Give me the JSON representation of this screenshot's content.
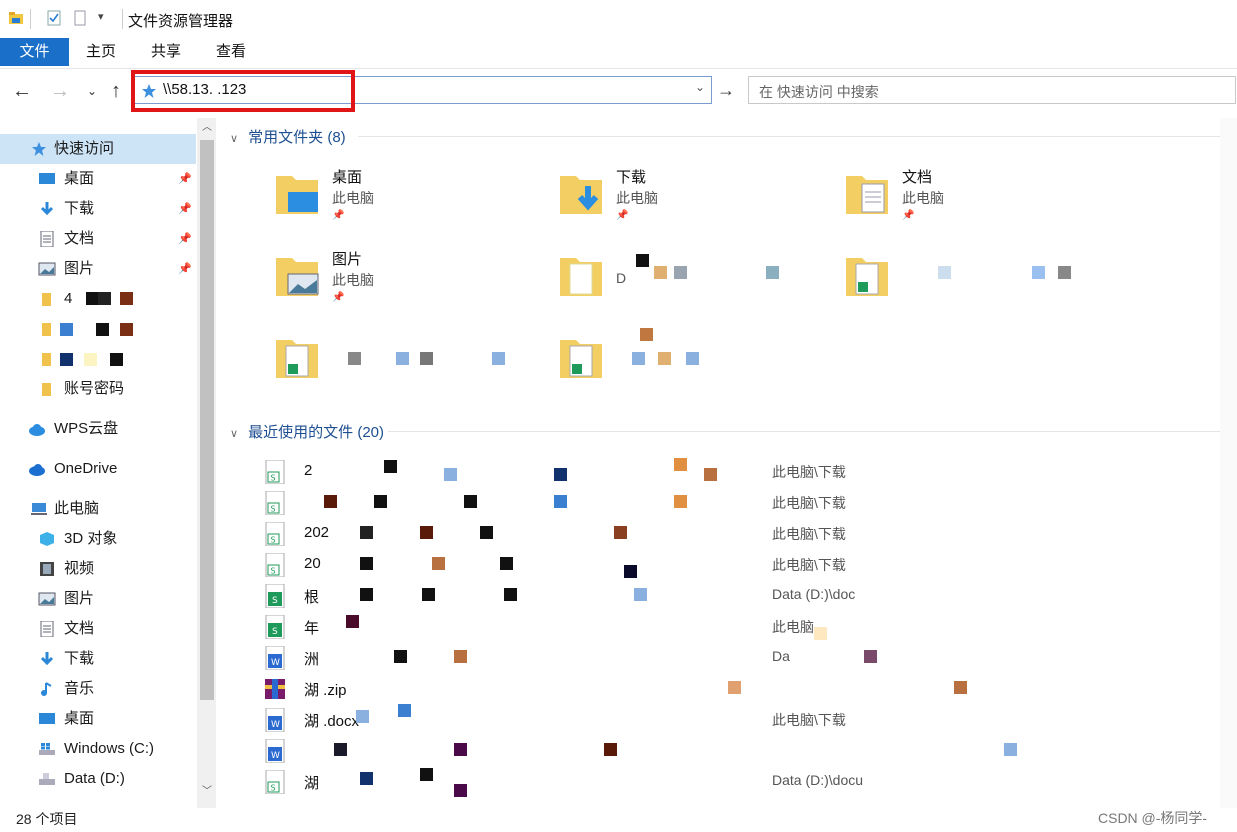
{
  "window": {
    "title": "文件资源管理器"
  },
  "ribbon": {
    "tabs": [
      "文件",
      "主页",
      "共享",
      "查看"
    ]
  },
  "address": {
    "path": "\\\\58.13.   .123",
    "search_placeholder": "在 快速访问 中搜索"
  },
  "sidebar": {
    "quick_access": "快速访问",
    "quick_items": [
      {
        "label": "桌面",
        "pinned": true
      },
      {
        "label": "下载",
        "pinned": true
      },
      {
        "label": "文档",
        "pinned": true
      },
      {
        "label": "图片",
        "pinned": true
      },
      {
        "label": "4",
        "pinned": false
      },
      {
        "label": "",
        "pinned": false
      },
      {
        "label": "",
        "pinned": false
      },
      {
        "label": "账号密码",
        "pinned": false
      }
    ],
    "wps": "WPS云盘",
    "onedrive": "OneDrive",
    "this_pc": "此电脑",
    "pc_items": [
      "3D 对象",
      "视频",
      "图片",
      "文档",
      "下载",
      "音乐",
      "桌面",
      "Windows (C:)",
      "Data (D:)"
    ]
  },
  "main": {
    "frequent_header": "常用文件夹 (8)",
    "frequent": [
      {
        "name": "桌面",
        "sub": "此电脑"
      },
      {
        "name": "下载",
        "sub": "此电脑"
      },
      {
        "name": "文档",
        "sub": "此电脑"
      },
      {
        "name": "图片",
        "sub": "此电脑"
      },
      {
        "name": "",
        "sub": "D"
      },
      {
        "name": "",
        "sub": ""
      },
      {
        "name": "",
        "sub": ""
      },
      {
        "name": "",
        "sub": ""
      }
    ],
    "recent_header": "最近使用的文件 (20)",
    "recent": [
      {
        "name": "2",
        "loc": "此电脑\\下载",
        "icon": "excel"
      },
      {
        "name": "",
        "loc": "此电脑\\下载",
        "icon": "excel"
      },
      {
        "name": "202",
        "loc": "此电脑\\下载",
        "icon": "excel"
      },
      {
        "name": "20",
        "loc": "此电脑\\下载",
        "icon": "excel"
      },
      {
        "name": "根",
        "loc": "Data (D:)\\doc",
        "icon": "excel-green"
      },
      {
        "name": "年",
        "loc": "此电脑",
        "icon": "excel-green"
      },
      {
        "name": "洲",
        "loc": "Da",
        "icon": "word"
      },
      {
        "name": "湖                    .zip",
        "loc": "",
        "icon": "rar"
      },
      {
        "name": "湖                    .docx",
        "loc": "此电脑\\下载",
        "icon": "word"
      },
      {
        "name": "",
        "loc": "",
        "icon": "word"
      },
      {
        "name": "湖",
        "loc": "Data (D:)\\docu",
        "icon": "excel"
      }
    ]
  },
  "status": {
    "items": "28 个项目"
  },
  "watermark": "CSDN @-杨同学-"
}
